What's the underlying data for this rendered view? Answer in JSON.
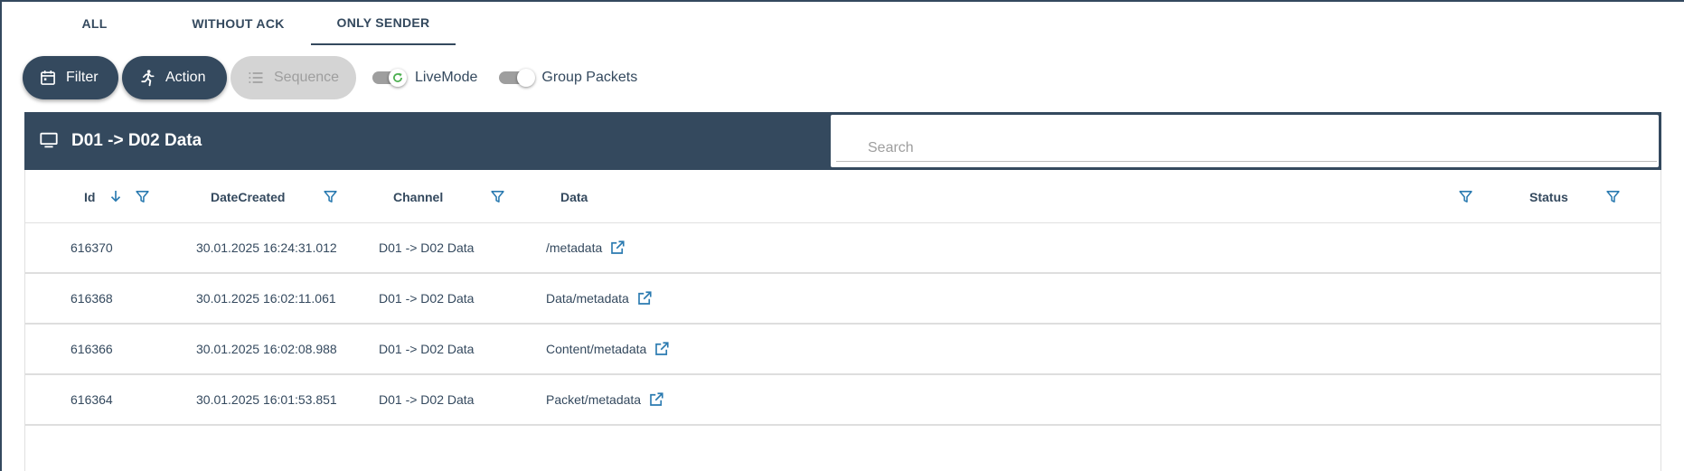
{
  "tabs": [
    {
      "label": "ALL"
    },
    {
      "label": "WITHOUT ACK"
    },
    {
      "label": "ONLY SENDER",
      "active": true
    }
  ],
  "toolbar": {
    "filter_label": "Filter",
    "action_label": "Action",
    "sequence_label": "Sequence",
    "live_mode_label": "LiveMode",
    "group_packets_label": "Group Packets"
  },
  "panel": {
    "title": "D01 -> D02 Data",
    "search_placeholder": "Search"
  },
  "table": {
    "columns": {
      "id": "Id",
      "date_created": "DateCreated",
      "channel": "Channel",
      "data": "Data",
      "status": "Status"
    },
    "rows": [
      {
        "id": "616370",
        "date": "30.01.2025 16:24:31.012",
        "channel": "D01 -> D02 Data",
        "data": "/metadata",
        "status": ""
      },
      {
        "id": "616368",
        "date": "30.01.2025 16:02:11.061",
        "channel": "D01 -> D02 Data",
        "data": "Data/metadata",
        "status": ""
      },
      {
        "id": "616366",
        "date": "30.01.2025 16:02:08.988",
        "channel": "D01 -> D02 Data",
        "data": "Content/metadata",
        "status": ""
      },
      {
        "id": "616364",
        "date": "30.01.2025 16:01:53.851",
        "channel": "D01 -> D02 Data",
        "data": "Packet/metadata",
        "status": ""
      }
    ]
  },
  "colors": {
    "primary": "#34495e",
    "accent_blue": "#2a7ab0",
    "live_green": "#4caf50",
    "disabled_bg": "#d4d4d4"
  },
  "icons": {
    "filter": "calendar-icon",
    "action": "running-person-icon",
    "sequence": "list-icon",
    "panel": "monitor-icon",
    "column_filter": "funnel-icon",
    "sort": "arrow-down-icon",
    "open": "open-external-icon"
  }
}
